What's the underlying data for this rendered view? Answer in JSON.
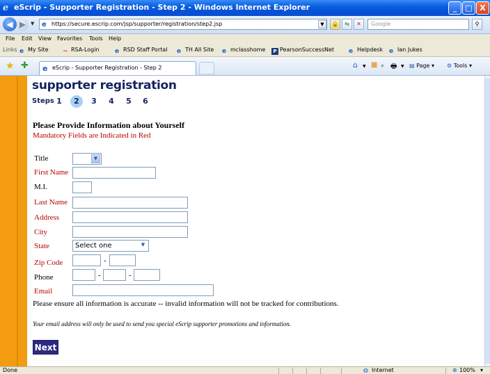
{
  "window": {
    "title": "eScrip - Supporter Registration - Step 2 - Windows Internet Explorer",
    "minimize": "_",
    "maximize": "□",
    "close": "X"
  },
  "address_bar": {
    "url": "https://secure.escrip.com/jsp/supporter/registration/step2.jsp",
    "search_placeholder": "Google"
  },
  "menu": [
    "File",
    "Edit",
    "View",
    "Favorites",
    "Tools",
    "Help"
  ],
  "links_bar": {
    "label": "Links",
    "items": [
      "My Site",
      "RSA-Login",
      "RSD Staff Portal",
      "TH All Site",
      "mclasshome",
      "PearsonSuccessNet",
      "Helpdesk",
      "Ian Jukes"
    ]
  },
  "tab": {
    "title": "eScrip - Supporter Registration - Step 2"
  },
  "command_bar": {
    "page_label": "Page",
    "tools_label": "Tools"
  },
  "page": {
    "heading": "supporter registration",
    "steps_label": "Steps",
    "steps": [
      "1",
      "2",
      "3",
      "4",
      "5",
      "6"
    ],
    "active_step": "2",
    "form_title": "Please Provide Information about Yourself",
    "mandatory_note": "Mandatory Fields are Indicated in Red",
    "fields": {
      "title": "Title",
      "first_name": "First Name",
      "mi": "M.I.",
      "last_name": "Last Name",
      "address": "Address",
      "city": "City",
      "state": "State",
      "state_value": "Select one",
      "zip": "Zip Code",
      "phone": "Phone",
      "email": "Email",
      "dash": "-"
    },
    "ensure_note": "Please ensure all information is accurate -- invalid information will not be tracked for contributions.",
    "email_note": "Your email address will only be used to send you special eScrip supporter promotions and information.",
    "next_button": "Next"
  },
  "status_bar": {
    "status": "Done",
    "zone": "Internet",
    "zoom": "100%"
  },
  "colors": {
    "accent_orange": "#f39c12",
    "heading_navy": "#13235f",
    "mandatory_red": "#b80000",
    "button_navy": "#2c2a80"
  }
}
